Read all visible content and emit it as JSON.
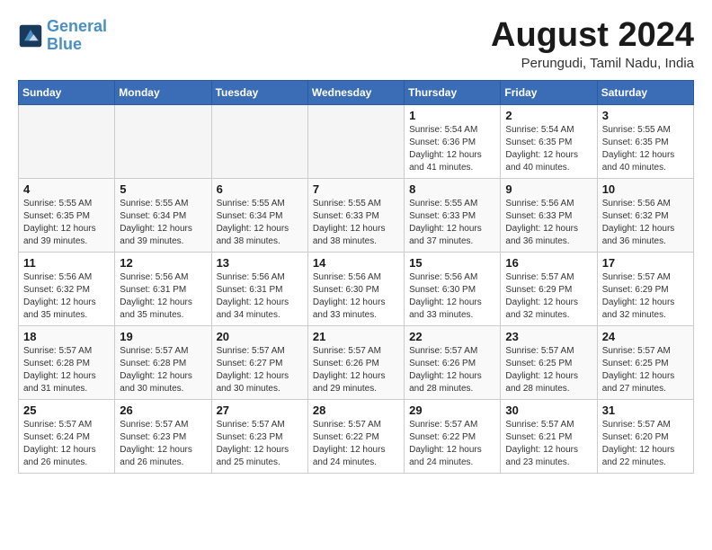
{
  "header": {
    "logo_line1": "General",
    "logo_line2": "Blue",
    "month_title": "August 2024",
    "subtitle": "Perungudi, Tamil Nadu, India"
  },
  "weekdays": [
    "Sunday",
    "Monday",
    "Tuesday",
    "Wednesday",
    "Thursday",
    "Friday",
    "Saturday"
  ],
  "weeks": [
    [
      {
        "day": "",
        "empty": true
      },
      {
        "day": "",
        "empty": true
      },
      {
        "day": "",
        "empty": true
      },
      {
        "day": "",
        "empty": true
      },
      {
        "day": "1",
        "sunrise": "5:54 AM",
        "sunset": "6:36 PM",
        "daylight": "12 hours and 41 minutes."
      },
      {
        "day": "2",
        "sunrise": "5:54 AM",
        "sunset": "6:35 PM",
        "daylight": "12 hours and 40 minutes."
      },
      {
        "day": "3",
        "sunrise": "5:55 AM",
        "sunset": "6:35 PM",
        "daylight": "12 hours and 40 minutes."
      }
    ],
    [
      {
        "day": "4",
        "sunrise": "5:55 AM",
        "sunset": "6:35 PM",
        "daylight": "12 hours and 39 minutes."
      },
      {
        "day": "5",
        "sunrise": "5:55 AM",
        "sunset": "6:34 PM",
        "daylight": "12 hours and 39 minutes."
      },
      {
        "day": "6",
        "sunrise": "5:55 AM",
        "sunset": "6:34 PM",
        "daylight": "12 hours and 38 minutes."
      },
      {
        "day": "7",
        "sunrise": "5:55 AM",
        "sunset": "6:33 PM",
        "daylight": "12 hours and 38 minutes."
      },
      {
        "day": "8",
        "sunrise": "5:55 AM",
        "sunset": "6:33 PM",
        "daylight": "12 hours and 37 minutes."
      },
      {
        "day": "9",
        "sunrise": "5:56 AM",
        "sunset": "6:33 PM",
        "daylight": "12 hours and 36 minutes."
      },
      {
        "day": "10",
        "sunrise": "5:56 AM",
        "sunset": "6:32 PM",
        "daylight": "12 hours and 36 minutes."
      }
    ],
    [
      {
        "day": "11",
        "sunrise": "5:56 AM",
        "sunset": "6:32 PM",
        "daylight": "12 hours and 35 minutes."
      },
      {
        "day": "12",
        "sunrise": "5:56 AM",
        "sunset": "6:31 PM",
        "daylight": "12 hours and 35 minutes."
      },
      {
        "day": "13",
        "sunrise": "5:56 AM",
        "sunset": "6:31 PM",
        "daylight": "12 hours and 34 minutes."
      },
      {
        "day": "14",
        "sunrise": "5:56 AM",
        "sunset": "6:30 PM",
        "daylight": "12 hours and 33 minutes."
      },
      {
        "day": "15",
        "sunrise": "5:56 AM",
        "sunset": "6:30 PM",
        "daylight": "12 hours and 33 minutes."
      },
      {
        "day": "16",
        "sunrise": "5:57 AM",
        "sunset": "6:29 PM",
        "daylight": "12 hours and 32 minutes."
      },
      {
        "day": "17",
        "sunrise": "5:57 AM",
        "sunset": "6:29 PM",
        "daylight": "12 hours and 32 minutes."
      }
    ],
    [
      {
        "day": "18",
        "sunrise": "5:57 AM",
        "sunset": "6:28 PM",
        "daylight": "12 hours and 31 minutes."
      },
      {
        "day": "19",
        "sunrise": "5:57 AM",
        "sunset": "6:28 PM",
        "daylight": "12 hours and 30 minutes."
      },
      {
        "day": "20",
        "sunrise": "5:57 AM",
        "sunset": "6:27 PM",
        "daylight": "12 hours and 30 minutes."
      },
      {
        "day": "21",
        "sunrise": "5:57 AM",
        "sunset": "6:26 PM",
        "daylight": "12 hours and 29 minutes."
      },
      {
        "day": "22",
        "sunrise": "5:57 AM",
        "sunset": "6:26 PM",
        "daylight": "12 hours and 28 minutes."
      },
      {
        "day": "23",
        "sunrise": "5:57 AM",
        "sunset": "6:25 PM",
        "daylight": "12 hours and 28 minutes."
      },
      {
        "day": "24",
        "sunrise": "5:57 AM",
        "sunset": "6:25 PM",
        "daylight": "12 hours and 27 minutes."
      }
    ],
    [
      {
        "day": "25",
        "sunrise": "5:57 AM",
        "sunset": "6:24 PM",
        "daylight": "12 hours and 26 minutes."
      },
      {
        "day": "26",
        "sunrise": "5:57 AM",
        "sunset": "6:23 PM",
        "daylight": "12 hours and 26 minutes."
      },
      {
        "day": "27",
        "sunrise": "5:57 AM",
        "sunset": "6:23 PM",
        "daylight": "12 hours and 25 minutes."
      },
      {
        "day": "28",
        "sunrise": "5:57 AM",
        "sunset": "6:22 PM",
        "daylight": "12 hours and 24 minutes."
      },
      {
        "day": "29",
        "sunrise": "5:57 AM",
        "sunset": "6:22 PM",
        "daylight": "12 hours and 24 minutes."
      },
      {
        "day": "30",
        "sunrise": "5:57 AM",
        "sunset": "6:21 PM",
        "daylight": "12 hours and 23 minutes."
      },
      {
        "day": "31",
        "sunrise": "5:57 AM",
        "sunset": "6:20 PM",
        "daylight": "12 hours and 22 minutes."
      }
    ]
  ],
  "labels": {
    "sunrise": "Sunrise:",
    "sunset": "Sunset:",
    "daylight": "Daylight:"
  }
}
